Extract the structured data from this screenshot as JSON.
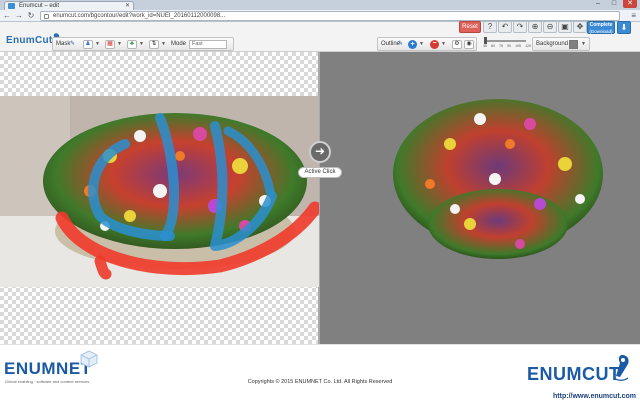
{
  "browser": {
    "tab_title": "Enumcut – edit",
    "url": "enumcut.com/bgcontour/edit?work_id=NUEI_20160112000098..."
  },
  "app": {
    "logo": "EnumCut",
    "reset_label": "Reset",
    "complete_label": "Complete",
    "complete_sub": "(Download)"
  },
  "left_toolbar": {
    "mask_label": "Mask",
    "mode_label": "Mode",
    "mode_value": "Fast"
  },
  "right_toolbar": {
    "outline_label": "Outline",
    "background_label": "Background",
    "slider_ticks": [
      "45",
      "60",
      "75",
      "90",
      "105",
      "120"
    ]
  },
  "canvas": {
    "active_click_label": "Active Click"
  },
  "footer": {
    "enumnet_logo": "ENUMNET",
    "enumnet_tagline": "Global enabling · software and content services",
    "copyright": "Copyrights © 2015 ENUMNET Co. Ltd. All Rights Reserved",
    "enumcut_logo": "ENUMCUT",
    "enumcut_url": "http://www.enumcut.com"
  },
  "colors": {
    "brand": "#1b5aa5",
    "reset": "#e0605a",
    "complete": "#3a8ad6",
    "canvas_bg": "#808080",
    "mark_foreground": "#2a8fd0",
    "mark_background": "#f03a2a"
  }
}
